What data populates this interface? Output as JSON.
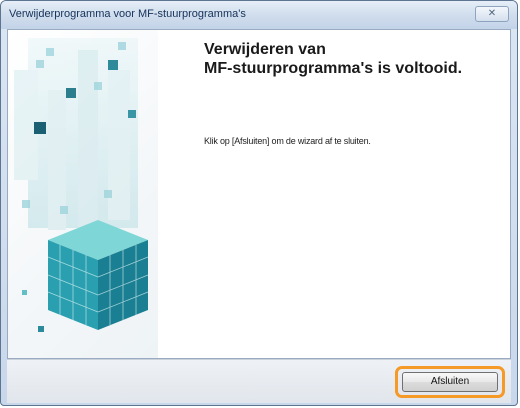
{
  "window": {
    "title": "Verwijderprogramma voor MF-stuurprogramma's",
    "close_glyph": "✕"
  },
  "main": {
    "heading_line1": "Verwijderen van",
    "heading_line2": "MF-stuurprogramma's is voltooid.",
    "instruction": "Klik op [Afsluiten] om de wizard af te sluiten."
  },
  "footer": {
    "close_button_label": "Afsluiten",
    "highlight_color": "#f59a26"
  },
  "illustration": {
    "name": "cube-graphic",
    "colors": [
      "#1f8fa3",
      "#33b3bc",
      "#5cc7c9",
      "#9edcd9"
    ]
  }
}
